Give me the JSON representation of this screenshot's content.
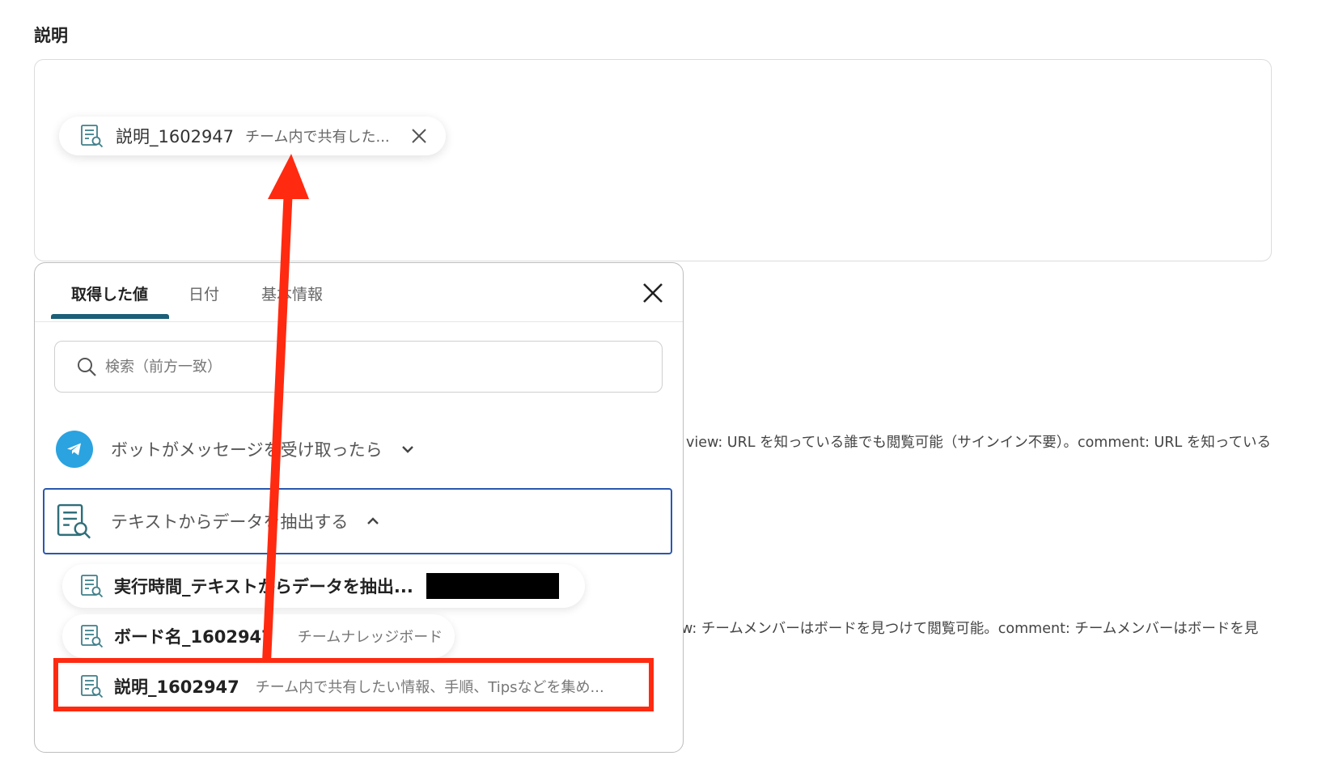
{
  "field": {
    "label": "説明",
    "chip": {
      "name": "説明_1602947",
      "preview": "チーム内で共有した..."
    }
  },
  "hints": {
    "hint1": "view: URL を知っている誰でも閲覧可能（サインイン不要）。comment: URL を知っている",
    "hint2": "w: チームメンバーはボードを見つけて閲覧可能。comment: チームメンバーはボードを見"
  },
  "panel": {
    "tabs": [
      {
        "label": "取得した値",
        "active": true
      },
      {
        "label": "日付",
        "active": false
      },
      {
        "label": "基本情報",
        "active": false
      }
    ],
    "search": {
      "placeholder": "検索（前方一致）",
      "value": ""
    },
    "groups": [
      {
        "label": "ボットがメッセージを受け取ったら",
        "expanded": false
      },
      {
        "label": "テキストからデータを抽出する",
        "expanded": true
      }
    ],
    "items": [
      {
        "name": "実行時間_テキストからデータを抽出...",
        "preview": ""
      },
      {
        "name": "ボード名_1602947",
        "preview": "チームナレッジボード"
      },
      {
        "name": "説明_1602947",
        "preview": "チーム内で共有したい情報、手順、Tipsなどを集め..."
      }
    ]
  },
  "colors": {
    "accent_tab": "#1b5f78",
    "selected_border": "#2a58b0",
    "annotation_red": "#ff2a10",
    "telegram_blue": "#2aa3e0"
  }
}
